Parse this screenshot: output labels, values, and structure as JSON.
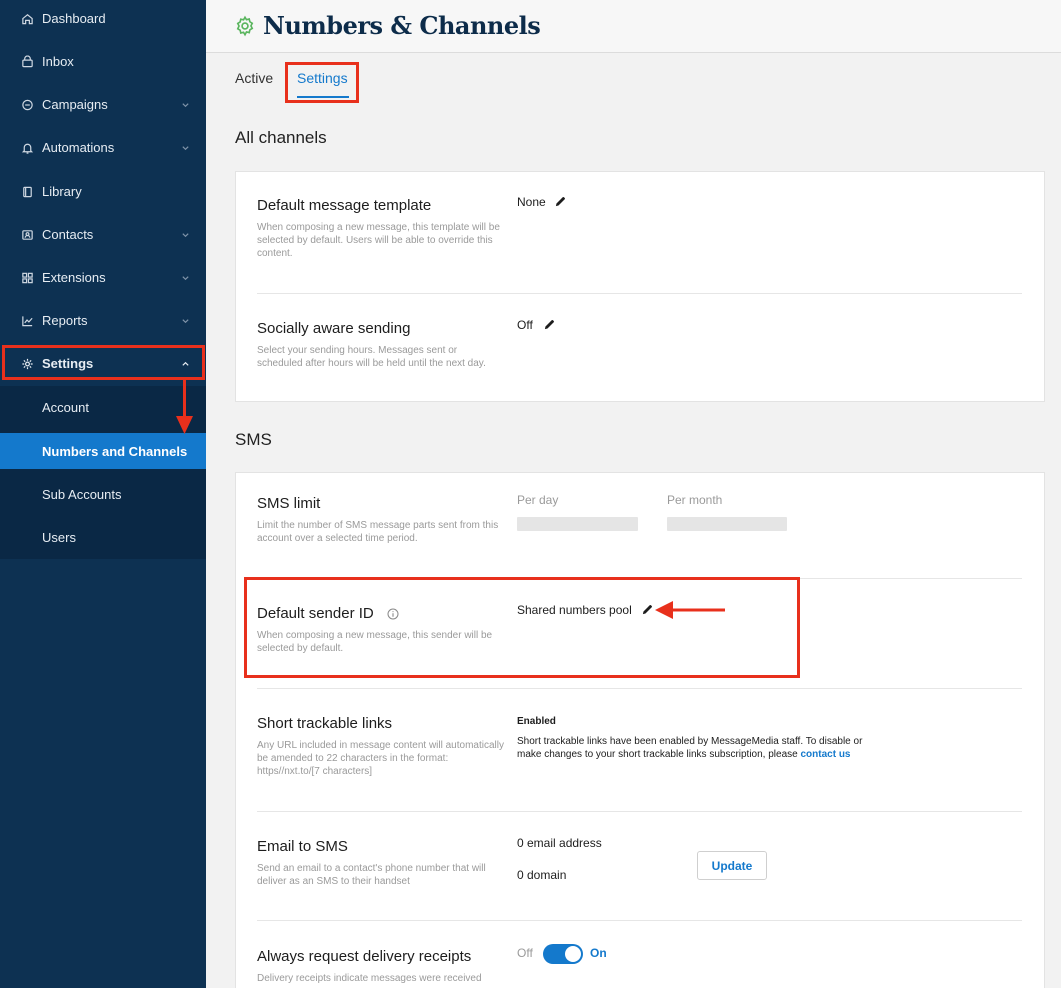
{
  "sidebar": {
    "items": [
      {
        "label": "Dashboard",
        "icon": "home-icon"
      },
      {
        "label": "Inbox",
        "icon": "inbox-icon"
      },
      {
        "label": "Campaigns",
        "icon": "campaigns-icon"
      },
      {
        "label": "Automations",
        "icon": "bell-icon"
      },
      {
        "label": "Library",
        "icon": "book-icon"
      },
      {
        "label": "Contacts",
        "icon": "contacts-icon"
      },
      {
        "label": "Extensions",
        "icon": "grid-icon"
      },
      {
        "label": "Reports",
        "icon": "chart-icon"
      },
      {
        "label": "Settings",
        "icon": "gear-icon"
      }
    ],
    "sub_items": [
      {
        "label": "Account"
      },
      {
        "label": "Numbers and Channels"
      },
      {
        "label": "Sub Accounts"
      },
      {
        "label": "Users"
      }
    ]
  },
  "header": {
    "title": "Numbers & Channels"
  },
  "tabs": [
    {
      "label": "Active"
    },
    {
      "label": "Settings"
    }
  ],
  "all_channels": {
    "title": "All channels",
    "default_template": {
      "title": "Default message template",
      "desc": "When composing a new message, this template will be selected by default. Users will be able to override this content.",
      "value": "None"
    },
    "socially_aware": {
      "title": "Socially aware sending",
      "desc": "Select your sending hours. Messages sent or scheduled after hours will be held until the next day.",
      "value": "Off"
    }
  },
  "sms": {
    "title": "SMS",
    "limit": {
      "title": "SMS limit",
      "desc": "Limit the number of SMS message parts sent from this account over a selected time period.",
      "per_day": "Per day",
      "per_month": "Per month"
    },
    "sender_id": {
      "title": "Default sender ID",
      "desc": "When composing a new message, this sender will be selected by default.",
      "value": "Shared numbers pool"
    },
    "short_links": {
      "title": "Short trackable links",
      "desc": "Any URL included in message content will automatically be amended to 22 characters in the format: https//nxt.to/[7 characters]",
      "status": "Enabled",
      "note": "Short trackable links have been enabled by MessageMedia staff. To disable or make changes to your short trackable links subscription, please",
      "link": "contact us"
    },
    "email_to_sms": {
      "title": "Email to SMS",
      "desc": "Send an email to a contact's phone number that will deliver as an SMS to their handset",
      "email_count": "0 email address",
      "domain_count": "0 domain",
      "button": "Update"
    },
    "delivery_receipts": {
      "title": "Always request delivery receipts",
      "desc": "Delivery receipts indicate messages were received",
      "off_label": "Off",
      "on_label": "On"
    }
  },
  "colors": {
    "accent": "#1479cc",
    "sidebar": "#0d3152",
    "highlight": "#e8301c",
    "gear": "#5ab55e"
  }
}
